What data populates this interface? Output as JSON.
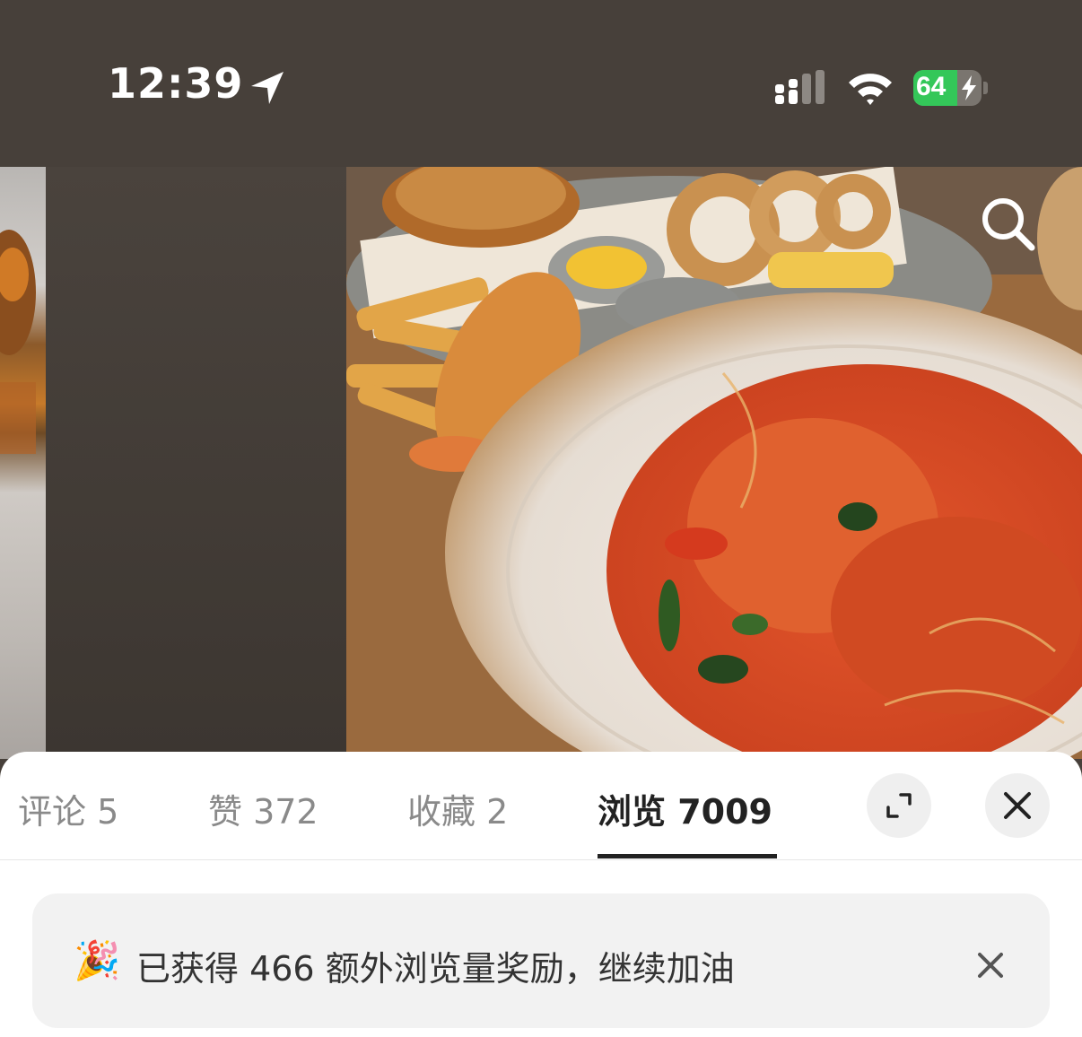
{
  "status_bar": {
    "time": "12:39",
    "battery_level": "64",
    "battery_fraction": 0.64,
    "icons": [
      "location-arrow-icon",
      "cellular-signal-icon",
      "wifi-icon",
      "battery-charging-icon"
    ]
  },
  "photo": {
    "search_icon": "search-icon"
  },
  "tabs": [
    {
      "label": "评论 5",
      "active": false
    },
    {
      "label": "赞 372",
      "active": false
    },
    {
      "label": "收藏 2",
      "active": false
    },
    {
      "label": "浏览 7009",
      "active": true
    }
  ],
  "actions": {
    "expand_icon": "expand-icon",
    "close_icon": "close-icon"
  },
  "banner": {
    "emoji": "🎉",
    "text": "已获得 466 额外浏览量奖励，继续加油",
    "close_icon": "close-icon"
  },
  "colors": {
    "background": "#47403a",
    "battery_green": "#34c759",
    "active_tab": "#222222",
    "inactive_tab": "#8a8a8a",
    "banner_bg": "#f2f2f2"
  }
}
